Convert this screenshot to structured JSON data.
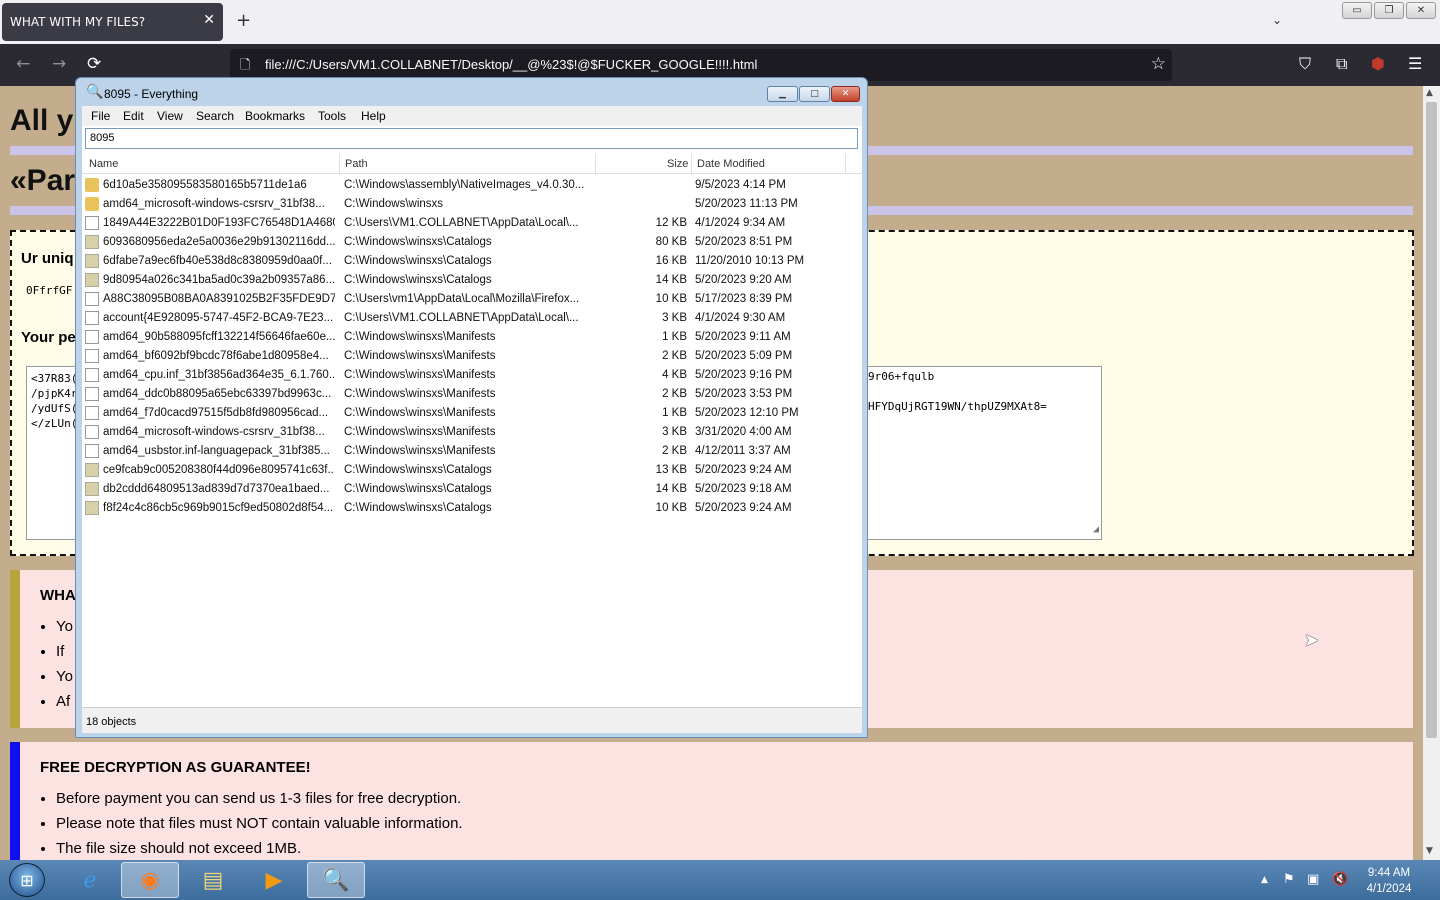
{
  "browser": {
    "tab_title": "WHAT WITH MY FILES?",
    "tab_close": "✕",
    "new_tab": "+",
    "tab_list": "⌄",
    "win_min": "▭",
    "win_restore": "❐",
    "win_close": "✕",
    "back": "←",
    "forward": "→",
    "reload": "⟳",
    "url": "file:///C:/Users/VM1.COLLABNET/Desktop/__@%23$!@$FUCKER_GOOGLE!!!!.html",
    "icons": {
      "page": "page-icon",
      "star": "star-icon",
      "pocket": "pocket-icon",
      "extensions": "extensions-icon",
      "ublock": "ublock-icon",
      "menu": "hamburger-menu-icon"
    }
  },
  "page": {
    "heading1": "All y",
    "heading2": "«Par",
    "unique_label": "Ur uniq",
    "unique_code": "0FfrfGF",
    "personal_label": "Your pe",
    "key_lines": [
      "<37R83(",
      "/pjpK4r",
      "/ydUfS(",
      "</zLUn("
    ],
    "key_right_lines": [
      "9r06+fqulb",
      "HFYDqUjRGT19WN/thpUZ9MXAt8="
    ],
    "warn_title": "WHAT",
    "warn_items": [
      "Yo",
      "If",
      "Yo",
      "Af"
    ],
    "free_title": "FREE DECRYPTION AS GUARANTEE!",
    "free_items": [
      "Before payment you can send us 1-3 files for free decryption.",
      "Please note that files must NOT contain valuable information.",
      "The file size should not exceed 1MB."
    ]
  },
  "everything": {
    "title": "8095 - Everything",
    "menu": [
      "File",
      "Edit",
      "View",
      "Search",
      "Bookmarks",
      "Tools",
      "Help"
    ],
    "search_value": "8095",
    "columns": {
      "name": "Name",
      "path": "Path",
      "size": "Size",
      "date": "Date Modified"
    },
    "rows": [
      {
        "icon": "folder",
        "name": "6d10a5e358095583580165b5711de1a6",
        "path": "C:\\Windows\\assembly\\NativeImages_v4.0.30...",
        "size": "",
        "date": "9/5/2023 4:14 PM"
      },
      {
        "icon": "folder",
        "name": "amd64_microsoft-windows-csrsrv_31bf38...",
        "path": "C:\\Windows\\winsxs",
        "size": "",
        "date": "5/20/2023 11:13 PM"
      },
      {
        "icon": "file",
        "name": "1849A44E3222B01D0F193FC76548D1A4680...",
        "path": "C:\\Users\\VM1.COLLABNET\\AppData\\Local\\...",
        "size": "12 KB",
        "date": "4/1/2024 9:34 AM"
      },
      {
        "icon": "cat",
        "name": "6093680956eda2e5a0036e29b91302116dd...",
        "path": "C:\\Windows\\winsxs\\Catalogs",
        "size": "80 KB",
        "date": "5/20/2023 8:51 PM"
      },
      {
        "icon": "cat",
        "name": "6dfabe7a9ec6fb40e538d8c8380959d0aa0f...",
        "path": "C:\\Windows\\winsxs\\Catalogs",
        "size": "16 KB",
        "date": "11/20/2010 10:13 PM"
      },
      {
        "icon": "cat",
        "name": "9d80954a026c341ba5ad0c39a2b09357a86...",
        "path": "C:\\Windows\\winsxs\\Catalogs",
        "size": "14 KB",
        "date": "5/20/2023 9:20 AM"
      },
      {
        "icon": "file",
        "name": "A88C38095B08BA0A8391025B2F35FDE9D7...",
        "path": "C:\\Users\\vm1\\AppData\\Local\\Mozilla\\Firefox...",
        "size": "10 KB",
        "date": "5/17/2023 8:39 PM"
      },
      {
        "icon": "file",
        "name": "account{4E928095-5747-45F2-BCA9-7E23...",
        "path": "C:\\Users\\VM1.COLLABNET\\AppData\\Local\\...",
        "size": "3 KB",
        "date": "4/1/2024 9:30 AM"
      },
      {
        "icon": "file",
        "name": "amd64_90b588095fcff132214f56646fae60e...",
        "path": "C:\\Windows\\winsxs\\Manifests",
        "size": "1 KB",
        "date": "5/20/2023 9:11 AM"
      },
      {
        "icon": "file",
        "name": "amd64_bf6092bf9bcdc78f6abe1d80958e4...",
        "path": "C:\\Windows\\winsxs\\Manifests",
        "size": "2 KB",
        "date": "5/20/2023 5:09 PM"
      },
      {
        "icon": "file",
        "name": "amd64_cpu.inf_31bf3856ad364e35_6.1.760...",
        "path": "C:\\Windows\\winsxs\\Manifests",
        "size": "4 KB",
        "date": "5/20/2023 9:16 PM"
      },
      {
        "icon": "file",
        "name": "amd64_ddc0b88095a65ebc63397bd9963c...",
        "path": "C:\\Windows\\winsxs\\Manifests",
        "size": "2 KB",
        "date": "5/20/2023 3:53 PM"
      },
      {
        "icon": "file",
        "name": "amd64_f7d0cacd97515f5db8fd980956cad...",
        "path": "C:\\Windows\\winsxs\\Manifests",
        "size": "1 KB",
        "date": "5/20/2023 12:10 PM"
      },
      {
        "icon": "file",
        "name": "amd64_microsoft-windows-csrsrv_31bf38...",
        "path": "C:\\Windows\\winsxs\\Manifests",
        "size": "3 KB",
        "date": "3/31/2020 4:00 AM"
      },
      {
        "icon": "file",
        "name": "amd64_usbstor.inf-languagepack_31bf385...",
        "path": "C:\\Windows\\winsxs\\Manifests",
        "size": "2 KB",
        "date": "4/12/2011 3:37 AM"
      },
      {
        "icon": "cat",
        "name": "ce9fcab9c005208380f44d096e8095741c63f...",
        "path": "C:\\Windows\\winsxs\\Catalogs",
        "size": "13 KB",
        "date": "5/20/2023 9:24 AM"
      },
      {
        "icon": "cat",
        "name": "db2cddd64809513ad839d7d7370ea1baed...",
        "path": "C:\\Windows\\winsxs\\Catalogs",
        "size": "14 KB",
        "date": "5/20/2023 9:18 AM"
      },
      {
        "icon": "cat",
        "name": "f8f24c4c86cb5c969b9015cf9ed50802d8f54...",
        "path": "C:\\Windows\\winsxs\\Catalogs",
        "size": "10 KB",
        "date": "5/20/2023 9:24 AM"
      }
    ],
    "status": "18 objects"
  },
  "taskbar": {
    "apps": [
      "start-orb",
      "internet-explorer",
      "firefox",
      "file-explorer",
      "media-player",
      "everything"
    ],
    "time": "9:44 AM",
    "date": "4/1/2024"
  },
  "colors": {
    "page_bg": "#c4ad8c",
    "key_box": "#fffde8",
    "warn_bg": "#fde2e2",
    "warn_border": "#b8a43c",
    "free_border": "#1010ee"
  }
}
